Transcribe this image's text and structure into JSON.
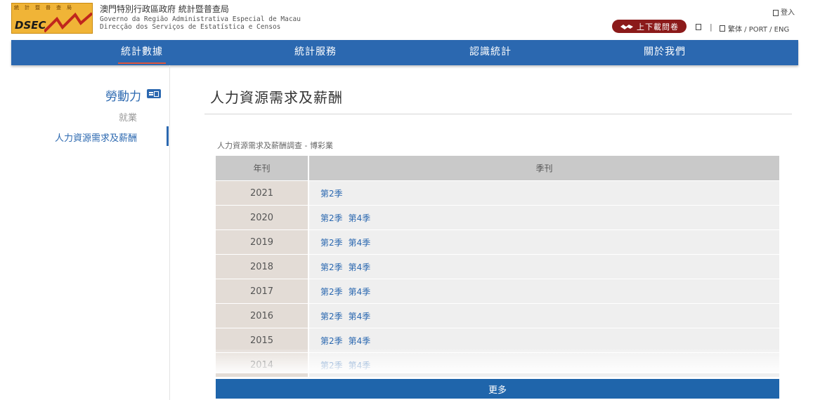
{
  "header": {
    "logo_text": "DSEC",
    "logo_chars": "統計暨普查局",
    "org_name_zh": "澳門特別行政區政府 統計暨普查局",
    "org_name_pt1": "Governo da Região Administrativa Especial de Macau",
    "org_name_pt2": "Direcção dos Serviços de Estatística e Censos",
    "login_label": "登入",
    "download_label": "上下載問卷",
    "separator": "|",
    "lang_label": "繁体 / PORT / ENG"
  },
  "nav": {
    "items": [
      {
        "label": "統計數據",
        "active": true
      },
      {
        "label": "統計服務",
        "active": false
      },
      {
        "label": "認識統計",
        "active": false
      },
      {
        "label": "關於我們",
        "active": false
      }
    ]
  },
  "sidebar": {
    "title": "勞動力",
    "items": [
      {
        "label": "就業",
        "active": false
      },
      {
        "label": "人力資源需求及薪酬",
        "active": true
      }
    ]
  },
  "main": {
    "title": "人力資源需求及薪酬",
    "section_label": "人力資源需求及薪酬調查 - 博彩業",
    "table": {
      "headers": [
        "年刊",
        "季刊"
      ],
      "rows": [
        {
          "year": "2021",
          "quarters": [
            "第2季"
          ]
        },
        {
          "year": "2020",
          "quarters": [
            "第2季",
            "第4季"
          ]
        },
        {
          "year": "2019",
          "quarters": [
            "第2季",
            "第4季"
          ]
        },
        {
          "year": "2018",
          "quarters": [
            "第2季",
            "第4季"
          ]
        },
        {
          "year": "2017",
          "quarters": [
            "第2季",
            "第4季"
          ]
        },
        {
          "year": "2016",
          "quarters": [
            "第2季",
            "第4季"
          ]
        },
        {
          "year": "2015",
          "quarters": [
            "第2季",
            "第4季"
          ]
        },
        {
          "year": "2014",
          "quarters": [
            "第2季",
            "第4季"
          ]
        }
      ]
    },
    "more_label": "更多"
  },
  "colors": {
    "nav_bg": "#2b68b0",
    "link": "#2b68b0",
    "download_bg": "#8b1a1a",
    "more_bg": "#1f65ab",
    "logo_bg": "#f0b437"
  }
}
